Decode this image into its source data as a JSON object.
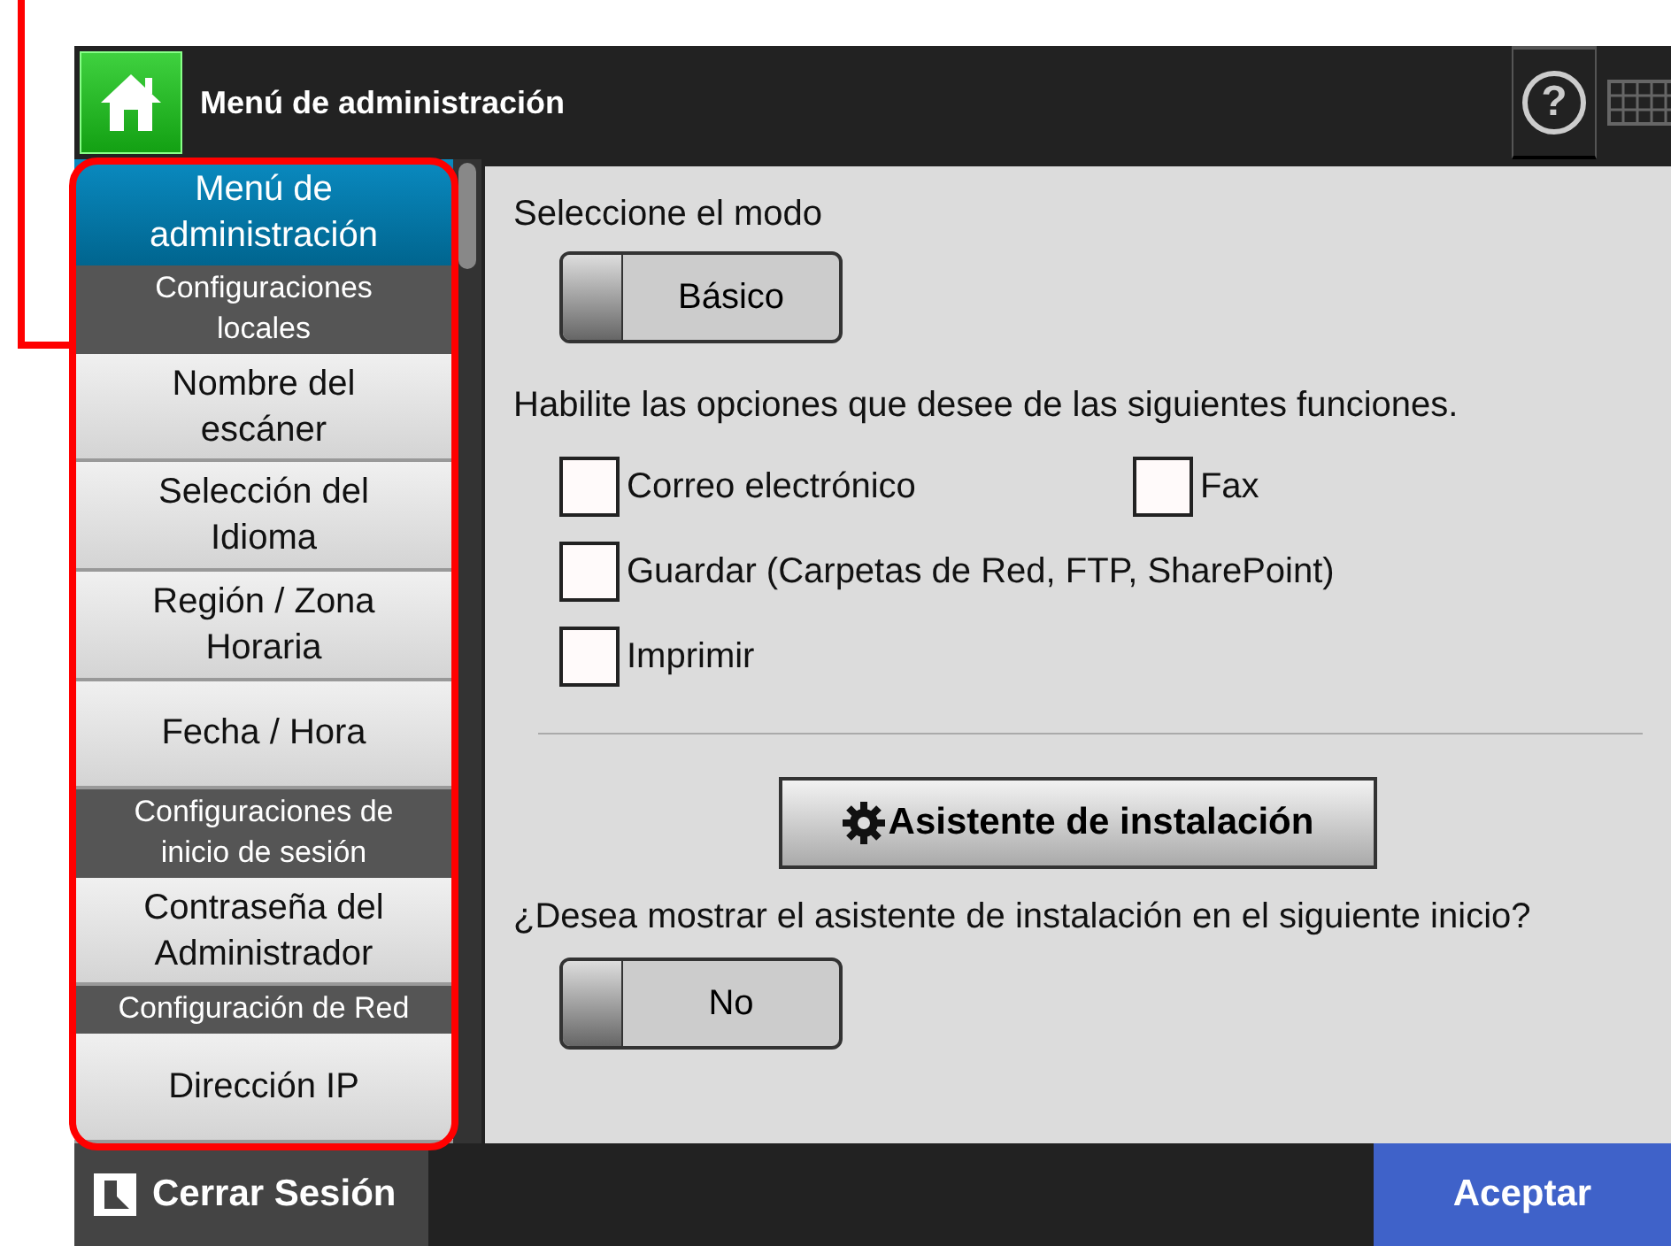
{
  "top_bar": {
    "title": "Menú de administración",
    "help": "?"
  },
  "sidebar": {
    "items": [
      {
        "kind": "header",
        "label": "Menú de administración",
        "selected": true
      },
      {
        "kind": "group",
        "label": "Configuraciones locales"
      },
      {
        "kind": "item",
        "label": "Nombre del escáner",
        "selected": false
      },
      {
        "kind": "item",
        "label": "Selección del Idioma",
        "selected": false
      },
      {
        "kind": "item",
        "label": "Región / Zona Horaria",
        "selected": false
      },
      {
        "kind": "item",
        "label": "Fecha / Hora",
        "selected": false
      },
      {
        "kind": "group",
        "label": "Configuraciones de inicio de sesión"
      },
      {
        "kind": "item",
        "label": "Contraseña del Administrador",
        "selected": false
      },
      {
        "kind": "group",
        "label": "Configuración de Red"
      },
      {
        "kind": "item",
        "label": "Dirección IP",
        "selected": false
      }
    ]
  },
  "content": {
    "mode_label": "Seleccione el modo",
    "mode_toggle": {
      "label": "Básico",
      "on": false
    },
    "functions_label": "Habilite las opciones que desee de las siguientes funciones.",
    "options": [
      {
        "label": "Correo electrónico",
        "checked": false
      },
      {
        "label": "Fax",
        "checked": false
      },
      {
        "label": "Guardar (Carpetas de Red, FTP, SharePoint)",
        "checked": false
      },
      {
        "label": "Imprimir",
        "checked": false
      }
    ],
    "wizard_button": "Asistente de instalación",
    "wizard_question": "¿Desea mostrar el asistente de instalación en el siguiente inicio?",
    "wizard_toggle": {
      "label": "No",
      "on": false
    }
  },
  "footer": {
    "logout": "Cerrar Sesión",
    "accept": "Aceptar"
  }
}
